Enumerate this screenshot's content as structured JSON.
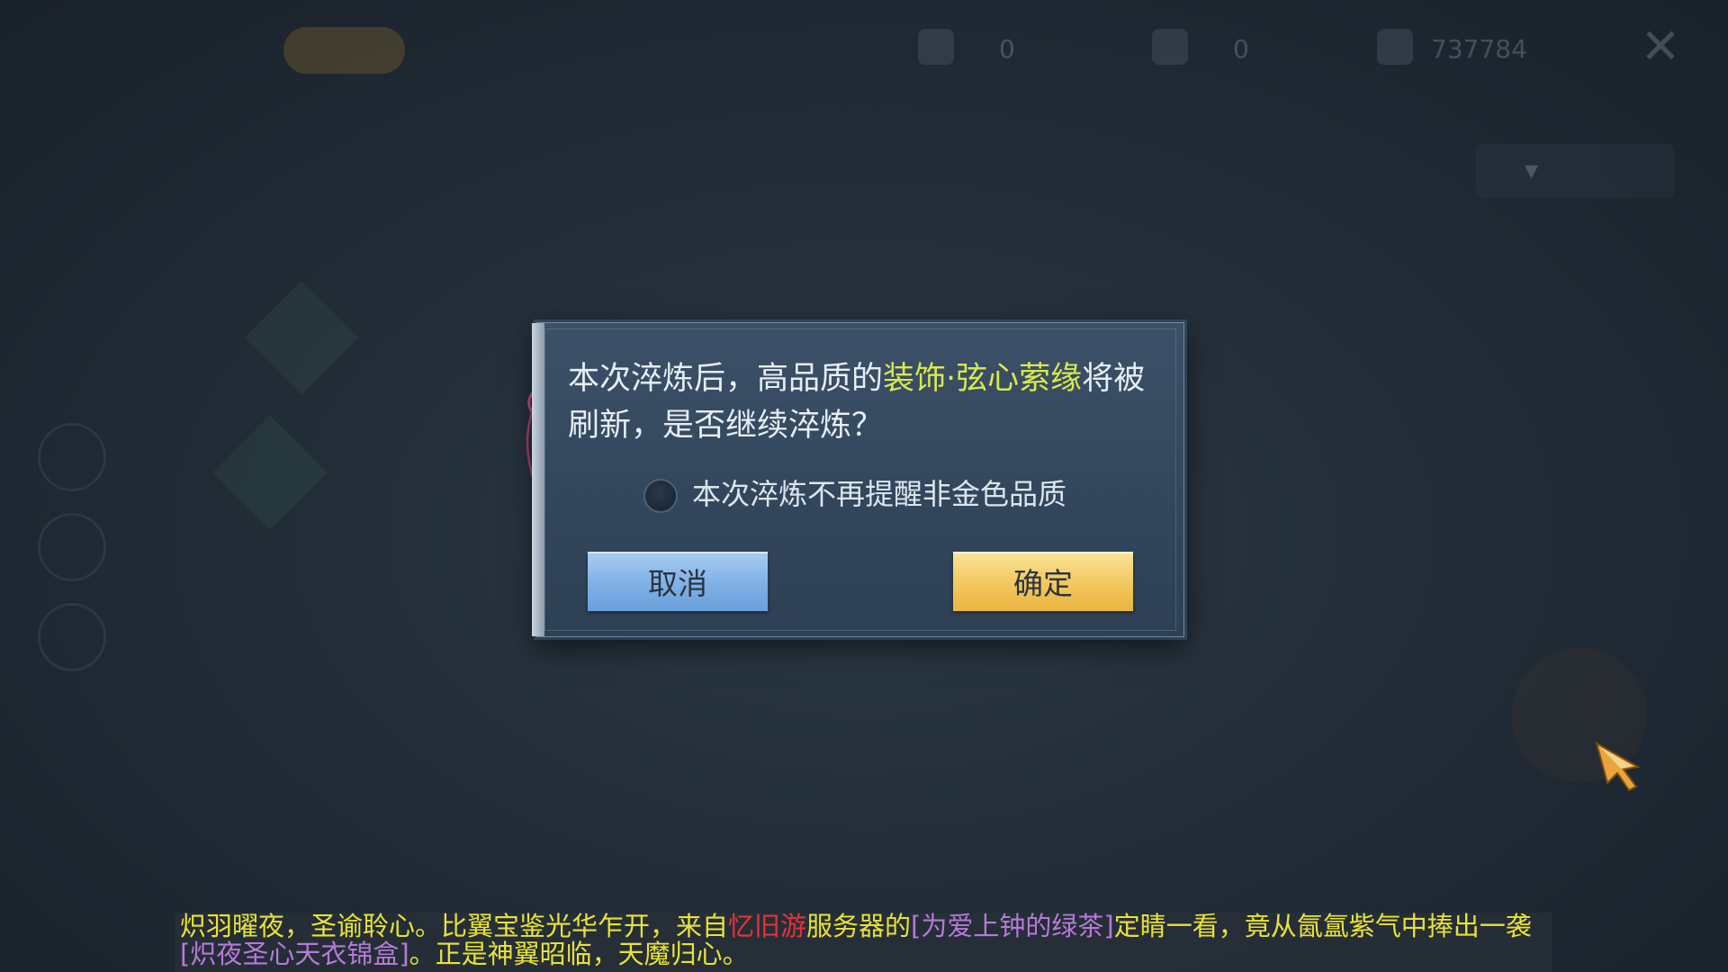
{
  "dialog": {
    "message_part1": "本次淬炼后，高品质的",
    "message_highlight": "装饰·弦心萦缘",
    "message_part2": "将被刷新，是否继续淬炼？",
    "checkbox_label": "本次淬炼不再提醒非金色品质",
    "checkbox_checked": false,
    "cancel_label": "取消",
    "confirm_label": "确定"
  },
  "broadcast": {
    "part1": "炽羽曜夜，圣谕聆心。比翼宝鉴光华乍开，来自",
    "server": "忆旧游",
    "part2": "服务器的",
    "player": "[为爱上钟的绿茶]",
    "part3": "定睛一看，竟从氤氲紫气中捧出一袭",
    "item": "[炽夜圣心天衣锦盒]",
    "part4": "。正是神翼昭临，天魔归心。"
  },
  "background": {
    "currency_1": "0",
    "currency_2": "0",
    "currency_3": "737784"
  },
  "colors": {
    "highlight": "#d8e84e",
    "cancel_button": "#7fb0e6",
    "confirm_button": "#f2c75c",
    "broadcast_text": "#e8e23a",
    "broadcast_server": "#e8323a",
    "broadcast_name": "#b67ad8"
  },
  "icons": [
    "close-icon",
    "cursor-arrow-icon",
    "ribbon-icon",
    "radio-icon"
  ]
}
